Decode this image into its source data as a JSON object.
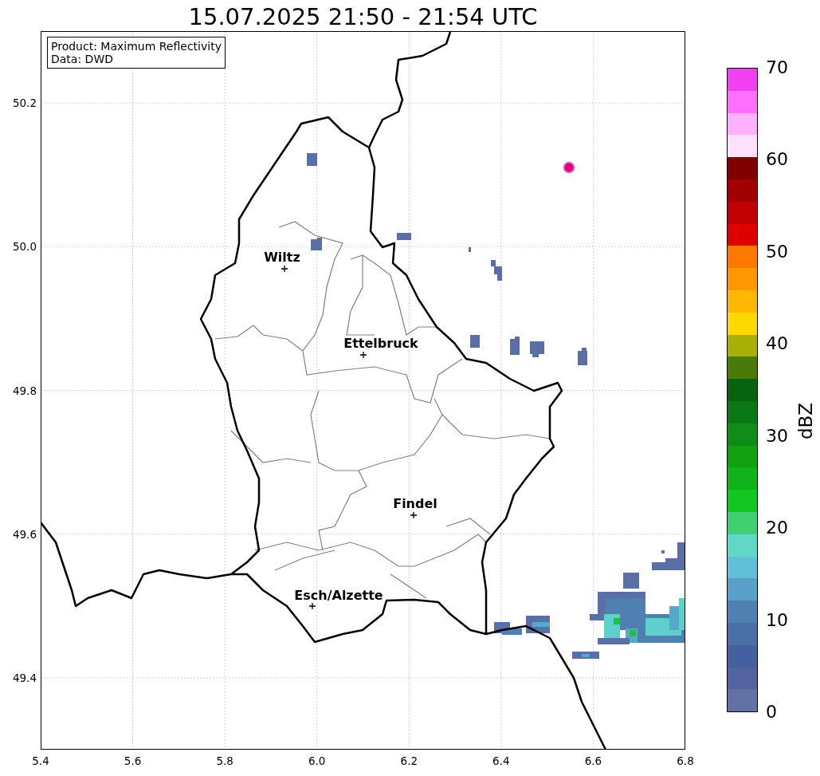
{
  "title": "15.07.2025 21:50 - 21:54 UTC",
  "info_box": [
    "Product: Maximum Reflectivity",
    "Data: DWD"
  ],
  "cities": [
    {
      "name": "Wiltz"
    },
    {
      "name": "Ettelbruck"
    },
    {
      "name": "Findel"
    },
    {
      "name": "Esch/Alzette"
    }
  ],
  "x_axis": {
    "ticks": [
      "5.4",
      "5.6",
      "5.8",
      "6.0",
      "6.2",
      "6.4",
      "6.6",
      "6.8"
    ]
  },
  "y_axis": {
    "ticks": [
      "50.2",
      "50.0",
      "49.8",
      "49.6",
      "49.4"
    ]
  },
  "colorbar": {
    "label": "dBZ",
    "ticks": [
      "70",
      "60",
      "50",
      "40",
      "30",
      "20",
      "10",
      "0"
    ],
    "bands": [
      {
        "color": "#f040f0"
      },
      {
        "color": "#ff70ff"
      },
      {
        "color": "#ffb0ff"
      },
      {
        "color": "#ffe0ff"
      },
      {
        "color": "#800000"
      },
      {
        "color": "#a00000"
      },
      {
        "color": "#c00000"
      },
      {
        "color": "#e00000"
      },
      {
        "color": "#ff7800"
      },
      {
        "color": "#ff9800"
      },
      {
        "color": "#ffb800"
      },
      {
        "color": "#ffd800"
      },
      {
        "color": "#a8b008"
      },
      {
        "color": "#4a7a08"
      },
      {
        "color": "#08640e"
      },
      {
        "color": "#0a7814"
      },
      {
        "color": "#108c18"
      },
      {
        "color": "#10a010"
      },
      {
        "color": "#10b418"
      },
      {
        "color": "#12c820"
      },
      {
        "color": "#40d070"
      },
      {
        "color": "#60d8c8"
      },
      {
        "color": "#60c0d8"
      },
      {
        "color": "#58a0c8"
      },
      {
        "color": "#4e80b2"
      },
      {
        "color": "#4a70a8"
      },
      {
        "color": "#4560a0"
      },
      {
        "color": "#5464a0"
      },
      {
        "color": "#6272a4"
      }
    ]
  }
}
